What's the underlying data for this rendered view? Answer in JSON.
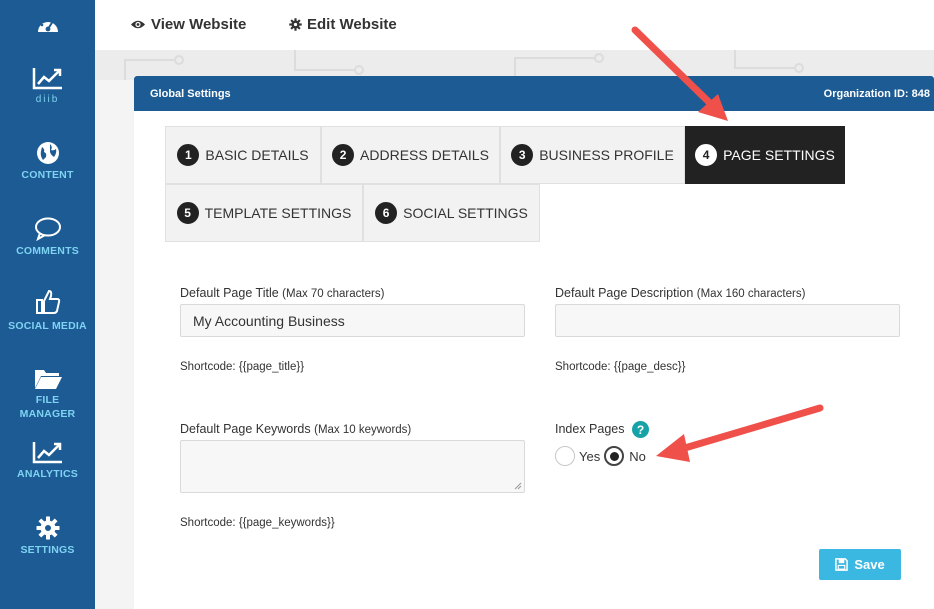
{
  "sidebar": {
    "items": [
      {
        "label": "",
        "icon": "dashboard-icon"
      },
      {
        "label": "diib",
        "icon": "trend-icon"
      },
      {
        "label": "CONTENT",
        "icon": "globe-icon"
      },
      {
        "label": "COMMENTS",
        "icon": "comment-icon"
      },
      {
        "label": "SOCIAL MEDIA",
        "icon": "thumbs-up-icon"
      },
      {
        "label": "FILE MANAGER",
        "icon": "folder-icon"
      },
      {
        "label": "ANALYTICS",
        "icon": "analytics-icon"
      },
      {
        "label": "SETTINGS",
        "icon": "gear-icon"
      }
    ]
  },
  "topbar": {
    "view_label": "View Website",
    "edit_label": "Edit Website"
  },
  "panel": {
    "title": "Global Settings",
    "org_id": "Organization ID: 848"
  },
  "tabs": [
    {
      "num": "1",
      "label": "BASIC DETAILS"
    },
    {
      "num": "2",
      "label": "ADDRESS DETAILS"
    },
    {
      "num": "3",
      "label": "BUSINESS PROFILE"
    },
    {
      "num": "4",
      "label": "PAGE SETTINGS"
    },
    {
      "num": "5",
      "label": "TEMPLATE SETTINGS"
    },
    {
      "num": "6",
      "label": "SOCIAL SETTINGS"
    }
  ],
  "form": {
    "title_label": "Default Page Title",
    "title_hint": "(Max 70 characters)",
    "title_value": "My Accounting Business",
    "title_shortcode": "Shortcode: {{page_title}}",
    "desc_label": "Default Page Description",
    "desc_hint": "(Max 160 characters)",
    "desc_value": "",
    "desc_shortcode": "Shortcode: {{page_desc}}",
    "keywords_label": "Default Page Keywords",
    "keywords_hint": "(Max 10 keywords)",
    "keywords_shortcode": "Shortcode: {{page_keywords}}",
    "index_label": "Index Pages",
    "help_glyph": "?",
    "yes_label": "Yes",
    "no_label": "No",
    "index_selected": "No",
    "save_label": "Save"
  },
  "colors": {
    "sidebar_bg": "#1c5b94",
    "sidebar_text": "#7fd3f2",
    "active_tab": "#222222",
    "save_button": "#3bb8e2",
    "annotation_arrow": "#f0504a"
  }
}
